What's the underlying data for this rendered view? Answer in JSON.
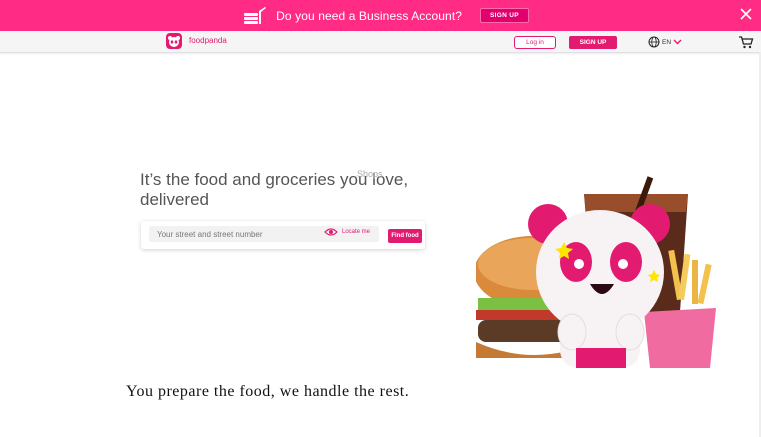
{
  "promo": {
    "text": "Do you need a Business Account?",
    "signup_label": "SIGN UP",
    "icon": "food-stack-icon",
    "close_icon": "close-icon",
    "color": "#ff2b85"
  },
  "header": {
    "logo_text": "foodpanda",
    "login_label": "Log in",
    "signup_label": "SIGN UP",
    "language": "EN",
    "globe_icon": "globe-icon",
    "chevron_icon": "chevron-down-icon",
    "cart_icon": "cart-icon",
    "brand_color": "#e21b70"
  },
  "hero": {
    "title": "It’s the food and groceries you love, delivered",
    "shops_label": "Shops",
    "search_placeholder": "Your street and street number",
    "locate_label": "Locate me",
    "find_label": "Find food",
    "locate_icon": "locate-icon"
  },
  "tagline": "You prepare the food, we handle the rest."
}
